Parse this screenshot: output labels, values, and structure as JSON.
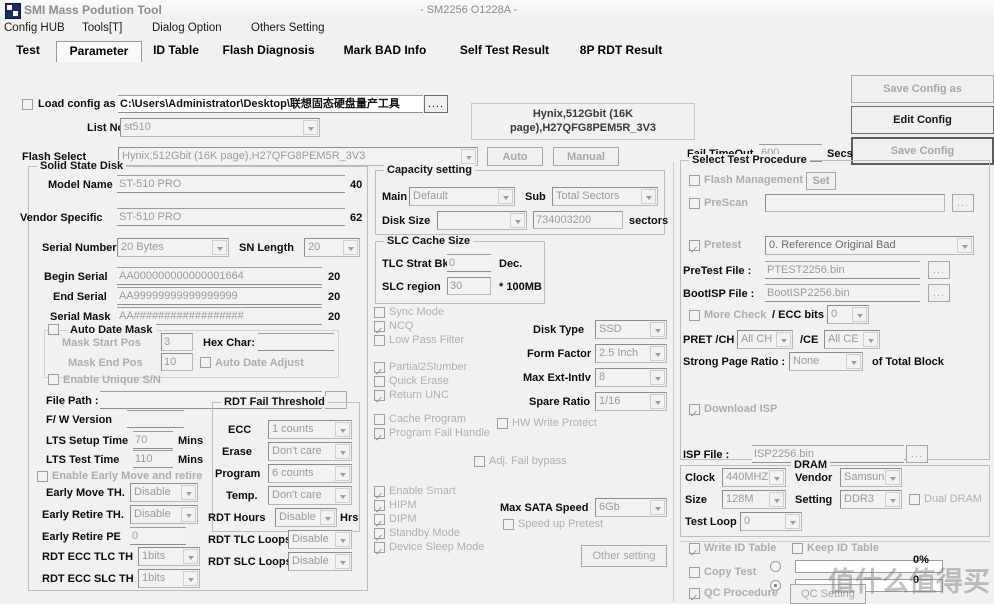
{
  "window": {
    "title": "SMI Mass Podution Tool",
    "subtitle": "- SM2256 O1228A -",
    "icon": "app-icon"
  },
  "menu": [
    "Config HUB",
    "Tools[T]",
    "Dialog Option",
    "Others Setting"
  ],
  "tabs": [
    {
      "label": "Test",
      "selected": false
    },
    {
      "label": "Parameter",
      "selected": true
    },
    {
      "label": "ID Table",
      "selected": false
    },
    {
      "label": "Flash Diagnosis",
      "selected": false
    },
    {
      "label": "Mark BAD Info",
      "selected": false
    },
    {
      "label": "Self Test Result",
      "selected": false
    },
    {
      "label": "8P RDT Result",
      "selected": false
    }
  ],
  "config": {
    "load_config_label": "Load config as",
    "load_config_checked": false,
    "path_value": "C:\\Users\\Administrator\\Desktop\\联想固态硬盘量产工具",
    "browse_label": "....",
    "list_no_label": "List No.",
    "list_no_value": "st510",
    "flash_select_label": "Flash Select",
    "flash_select_value": "Hynix,512Gbit (16K page),H27QFG8PEM5R_3V3",
    "flash_info_value": "Hynix,512Gbit (16K page),H27QFG8PEM5R_3V3",
    "auto_label": "Auto",
    "manual_label": "Manual",
    "save_config_as_label": "Save Config as",
    "edit_config_label": "Edit Config",
    "save_config_label": "Save Config",
    "fail_timeout_label": "Fail TimeOut",
    "fail_timeout_value": "600",
    "secs_label": "Secs"
  },
  "ssd": {
    "group_title": "Solid State Disk",
    "model_name_label": "Model Name",
    "model_name_value": "ST-510 PRO",
    "model_name_len": "40",
    "vendor_specific_label": "Vendor Specific",
    "vendor_specific_value": "ST-510 PRO",
    "vendor_specific_len": "62",
    "serial_number_label": "Serial Number",
    "serial_number_value": "20 Bytes",
    "sn_length_label": "SN Length",
    "sn_length_value": "20",
    "begin_serial_label": "Begin Serial",
    "begin_serial_value": "AA000000000000001664",
    "begin_serial_len": "20",
    "end_serial_label": "End Serial",
    "end_serial_value": "AA99999999999999999",
    "end_serial_len": "20",
    "serial_mask_label": "Serial Mask",
    "serial_mask_value": "AA##################",
    "serial_mask_len": "20",
    "auto_date_mask_label": "Auto Date Mask",
    "auto_date_mask_checked": false,
    "mask_start_pos_label": "Mask Start Pos",
    "mask_start_pos_value": "3",
    "mask_end_pos_label": "Mask End Pos",
    "mask_end_pos_value": "10",
    "hex_char_label": "Hex Char:",
    "hex_char_value": "",
    "auto_date_adjust_label": "Auto Date Adjust",
    "auto_date_adjust_checked": false,
    "enable_unique_sn_label": "Enable Unique S/N",
    "enable_unique_sn_checked": false,
    "file_path_label": "File Path :",
    "file_path_value": "",
    "fw_version_label": "F/ W Version",
    "fw_version_value": "",
    "lts_setup_time_label": "LTS Setup Time",
    "lts_setup_time_value": "70",
    "lts_setup_time_unit": "Mins",
    "lts_test_time_label": "LTS Test Time",
    "lts_test_time_value": "110",
    "lts_test_time_unit": "Mins",
    "enable_early_move_label": "Enable Early Move and retire",
    "enable_early_move_checked": false,
    "early_move_th_label": "Early Move TH.",
    "early_move_th_value": "Disable",
    "early_retire_th_label": "Early Retire TH.",
    "early_retire_th_value": "Disable",
    "early_retire_pe_label": "Early Retire PE",
    "early_retire_pe_value": "0",
    "rdt_ecc_tlc_th_label": "RDT ECC TLC TH",
    "rdt_ecc_tlc_th_value": "1bits",
    "rdt_ecc_slc_th_label": "RDT ECC SLC TH",
    "rdt_ecc_slc_th_value": "1bits"
  },
  "rdt_fail_threshold": {
    "group_title": "RDT Fail Threshold",
    "ecc_label": "ECC",
    "ecc_value": "1 counts",
    "erase_label": "Erase",
    "erase_value": "Don't care",
    "program_label": "Program",
    "program_value": "6 counts",
    "temp_label": "Temp.",
    "temp_value": "Don't care",
    "rdt_hours_label": "RDT Hours",
    "rdt_hours_value": "Disable",
    "rdt_hours_unit": "Hrs",
    "rdt_tlc_loops_label": "RDT TLC Loops",
    "rdt_tlc_loops_value": "Disable",
    "rdt_slc_loops_label": "RDT SLC Loops",
    "rdt_slc_loops_value": "Disable"
  },
  "capacity": {
    "group_title": "Capacity setting",
    "main_label": "Main",
    "main_value": "Default",
    "sub_label": "Sub",
    "sub_value": "Total Sectors",
    "disk_size_label": "Disk Size",
    "disk_size_value": "",
    "sectors_value": "734003200",
    "sectors_label": "sectors"
  },
  "slc_cache": {
    "group_title": "SLC Cache Size",
    "tlc_strat_bk_label": "TLC Strat Bk",
    "tlc_strat_bk_value": "0",
    "dec_label": "Dec.",
    "slc_region_label": "SLC region",
    "slc_region_value": "30",
    "slc_region_unit": "* 100MB"
  },
  "feature_checks": [
    {
      "label": "Sync Mode",
      "checked": false
    },
    {
      "label": "NCQ",
      "checked": true
    },
    {
      "label": "Low Pass Filter",
      "checked": false
    },
    {
      "label": "Partial2Slumber",
      "checked": true
    },
    {
      "label": "Quick Erase",
      "checked": false
    },
    {
      "label": "Return UNC",
      "checked": true
    },
    {
      "label": "Cache Program",
      "checked": false
    },
    {
      "label": "Program Fail Handle",
      "checked": true
    },
    {
      "label": "Enable Smart",
      "checked": true
    },
    {
      "label": "HIPM",
      "checked": true
    },
    {
      "label": "DIPM",
      "checked": true
    },
    {
      "label": "Standby Mode",
      "checked": true
    },
    {
      "label": "Device Sleep Mode",
      "checked": true
    }
  ],
  "disk_opts": {
    "disk_type_label": "Disk Type",
    "disk_type_value": "SSD",
    "form_factor_label": "Form Factor",
    "form_factor_value": "2.5 Inch",
    "max_ext_intlv_label": "Max Ext-Intlv",
    "max_ext_intlv_value": "8",
    "spare_ratio_label": "Spare Ratio",
    "spare_ratio_value": "1/16",
    "hw_write_protect_label": "HW Write Protect",
    "hw_write_protect_checked": false,
    "adj_fail_bypass_label": "Adj. Fail bypass",
    "adj_fail_bypass_checked": false,
    "max_sata_speed_label": "Max SATA Speed",
    "max_sata_speed_value": "6Gb",
    "speed_up_pretest_label": "Speed up Pretest",
    "speed_up_pretest_checked": false,
    "other_setting_label": "Other setting"
  },
  "test_procedure": {
    "group_title": "Select Test Procedure",
    "flash_management_label": "Flash Management",
    "flash_management_checked": false,
    "set_label": "Set",
    "prescan_label": "PreScan",
    "prescan_checked": false,
    "prescan_value": "",
    "prescan_browse": "...",
    "pretest_label": "Pretest",
    "pretest_checked": true,
    "pretest_value": "0. Reference Original Bad",
    "pretest_file_label": "PreTest File :",
    "pretest_file_value": "PTEST2256.bin",
    "bootisp_file_label": "BootISP File :",
    "bootisp_file_value": "BootISP2256.bin",
    "more_check_label": "More Check",
    "more_check_checked": false,
    "ecc_bits_label": "/ ECC bits",
    "ecc_bits_value": "0",
    "pret_ch_label": "PRET /CH",
    "pret_ch_value": "All CH",
    "ce_label": "/CE",
    "ce_value": "All CE",
    "strong_page_ratio_label": "Strong Page Ratio :",
    "strong_page_ratio_value": "None",
    "of_total_block_label": "of Total Block",
    "download_isp_label": "Download ISP",
    "download_isp_checked": true,
    "isp_file_label": "ISP File :",
    "isp_file_value": "ISP2256.bin",
    "isp_browse": "..."
  },
  "dram": {
    "group_title": "DRAM",
    "clock_label": "Clock",
    "clock_value": "440MHZ",
    "vendor_label": "Vendor",
    "vendor_value": "Samsun",
    "size_label": "Size",
    "size_value": "128M",
    "setting_label": "Setting",
    "setting_value": "DDR3",
    "dual_dram_label": "Dual DRAM",
    "dual_dram_checked": false,
    "test_loop_label": "Test Loop",
    "test_loop_value": "0"
  },
  "bottom": {
    "write_id_table_label": "Write ID Table",
    "write_id_table_checked": true,
    "keep_id_table_label": "Keep ID Table",
    "keep_id_table_checked": false,
    "copy_test_label": "Copy Test",
    "copy_test_checked": false,
    "qc_procedure_label": "QC Procedure",
    "qc_procedure_checked": true,
    "qc_setting_label": "QC Setting",
    "progress_top_pct": "0%",
    "progress_bottom_pct": "0",
    "radio_top_selected": false,
    "radio_bottom_selected": true
  },
  "watermark": "值什么值得买"
}
